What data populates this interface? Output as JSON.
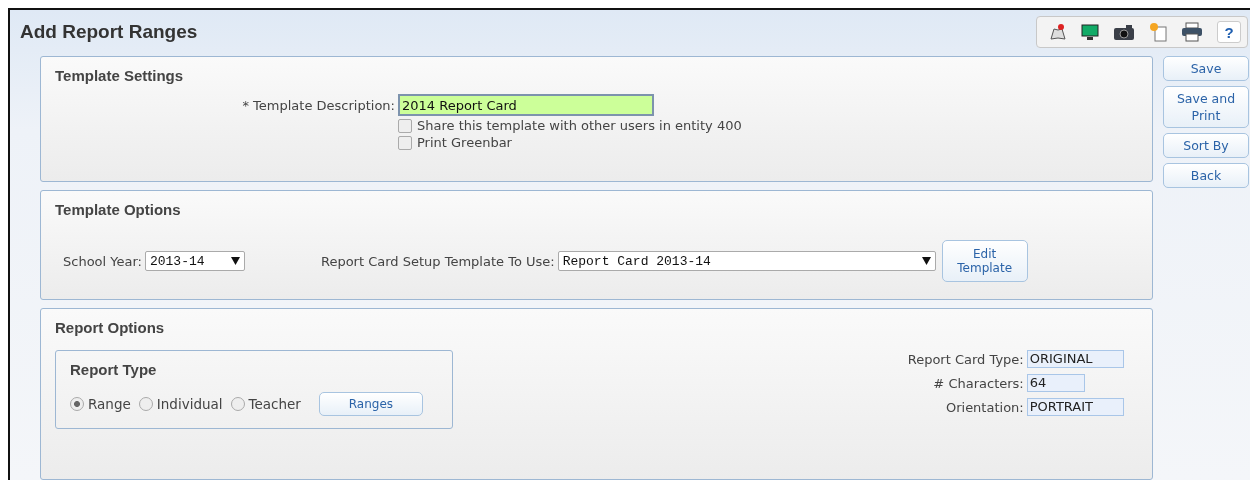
{
  "window": {
    "title": "Add Report Ranges"
  },
  "toolbar": [
    {
      "kind": "map"
    },
    {
      "kind": "monitor"
    },
    {
      "kind": "camera"
    },
    {
      "kind": "note"
    },
    {
      "kind": "print"
    },
    {
      "kind": "help",
      "label": "?"
    }
  ],
  "side_buttons": [
    {
      "label": "Save"
    },
    {
      "label": "Save and Print"
    },
    {
      "label": "Sort By"
    },
    {
      "label": "Back"
    }
  ],
  "template_settings": {
    "title": "Template Settings",
    "description_label": "* Template Description:",
    "description_value": "2014 Report Card",
    "checkboxes": [
      {
        "label": "Share this template with other users in entity 400",
        "checked": false
      },
      {
        "label": "Print Greenbar",
        "checked": false
      }
    ]
  },
  "template_options": {
    "title": "Template Options",
    "school_year_label": "School Year:",
    "school_year": "2013-14",
    "template_label": "Report Card Setup Template To Use:",
    "template": "Report Card 2013-14",
    "edit_button": "Edit Template"
  },
  "report_options": {
    "title": "Report Options",
    "report_type": {
      "title": "Report Type",
      "options": [
        {
          "label": "Range",
          "selected": true
        },
        {
          "label": "Individual",
          "selected": false
        },
        {
          "label": "Teacher",
          "selected": false
        }
      ],
      "button": "Ranges"
    },
    "fields": [
      {
        "label": "Report Card Type:",
        "value": "ORIGINAL"
      },
      {
        "label": "# Characters:",
        "value": "64"
      },
      {
        "label": "Orientation:",
        "value": "PORTRAIT"
      }
    ]
  }
}
